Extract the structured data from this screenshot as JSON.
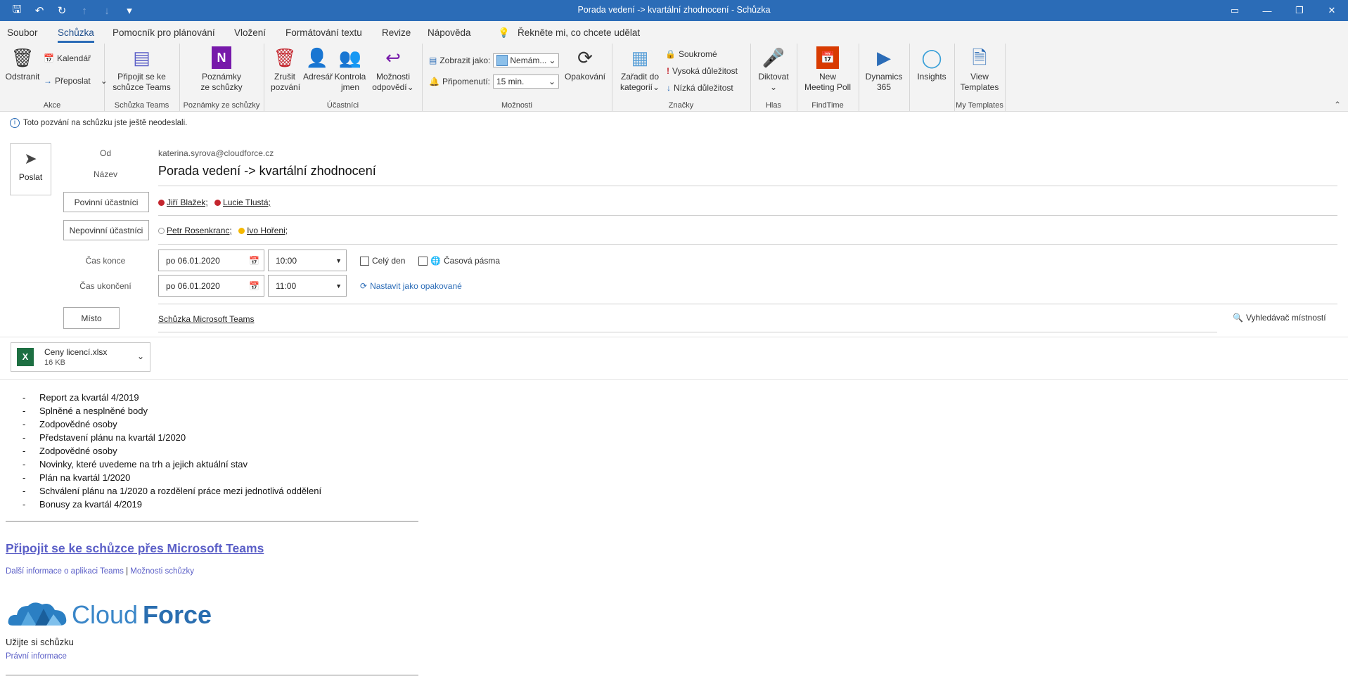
{
  "window": {
    "title": "Porada vedení -> kvartální zhodnocení  -  Schůzka"
  },
  "menu": {
    "tabs": [
      "Soubor",
      "Schůzka",
      "Pomocník pro plánování",
      "Vložení",
      "Formátování textu",
      "Revize",
      "Nápověda"
    ],
    "tell_me": "Řekněte mi, co chcete udělat"
  },
  "ribbon": {
    "akce": {
      "label": "Akce",
      "delete": "Odstranit",
      "calendar": "Kalendář",
      "forward": "Přeposlat"
    },
    "teams": {
      "label": "Schůzka Teams",
      "join_1": "Připojit se ke",
      "join_2": "schůzce Teams"
    },
    "notes": {
      "label": "Poznámky ze schůzky",
      "btn_1": "Poznámky",
      "btn_2": "ze schůzky"
    },
    "attendees": {
      "label": "Účastníci",
      "cancel_1": "Zrušit",
      "cancel_2": "pozvání",
      "address": "Adresář",
      "check_1": "Kontrola",
      "check_2": "jmen",
      "options_1": "Možnosti",
      "options_2": "odpovědí"
    },
    "options": {
      "label": "Možnosti",
      "show_as": "Zobrazit jako:",
      "show_as_value": "Nemám...",
      "reminder": "Připomenutí:",
      "reminder_value": "15 min.",
      "recurrence": "Opakování"
    },
    "tags": {
      "label": "Značky",
      "categorize_1": "Zařadit do",
      "categorize_2": "kategorií",
      "private": "Soukromé",
      "high": "Vysoká důležitost",
      "low": "Nízká důležitost"
    },
    "voice": {
      "label": "Hlas",
      "dictate": "Diktovat"
    },
    "findtime": {
      "label": "FindTime",
      "btn_1": "New",
      "btn_2": "Meeting Poll"
    },
    "dynamics": {
      "btn_1": "Dynamics",
      "btn_2": "365"
    },
    "insights": {
      "btn": "Insights"
    },
    "templates": {
      "label": "My Templates",
      "btn_1": "View",
      "btn_2": "Templates"
    }
  },
  "infobar": {
    "text": "Toto pozvání na schůzku jste ještě neodeslali."
  },
  "form": {
    "send": "Poslat",
    "from_label": "Od",
    "from_value": "katerina.syrova@cloudforce.cz",
    "subject_label": "Název",
    "subject_value": "Porada vedení -> kvartální zhodnocení",
    "required_btn": "Povinní účastníci",
    "required": [
      "Jiří Blažek;",
      "Lucie Tlustá;"
    ],
    "optional_btn": "Nepovinní účastníci",
    "optional": [
      "Petr Rosenkranc;",
      "Ivo Hořeni;"
    ],
    "start_label": "Čas konce",
    "start_date": "po 06.01.2020",
    "start_time": "10:00",
    "end_label": "Čas ukončení",
    "end_date": "po 06.01.2020",
    "end_time": "11:00",
    "allday": "Celý den",
    "timezones": "Časová pásma",
    "recurring": "Nastavit jako opakované",
    "location_btn": "Místo",
    "location_value": "Schůzka Microsoft Teams",
    "room_finder": "Vyhledávač místností"
  },
  "attachment": {
    "name": "Ceny licencí.xlsx",
    "size": "16 KB"
  },
  "body": {
    "items": [
      "Report za kvartál 4/2019",
      "Splněné a nesplněné body",
      "Zodpovědné osoby",
      "Představení plánu na kvartál 1/2020",
      "Zodpovědné osoby",
      "Novinky, které uvedeme na trh a jejich aktuální stav",
      "Plán na kvartál 1/2020",
      "Schválení plánu na 1/2020 a rozdělení práce mezi jednotlivá oddělení",
      "Bonusy za kvartál 4/2019"
    ],
    "join_link": "Připojit se ke schůzce přes Microsoft Teams",
    "more_info": "Další informace o aplikaci Teams",
    "separator": "|",
    "meeting_options": "Možnosti schůzky",
    "logo_cloud": "Cloud",
    "logo_force": "Force",
    "enjoy": "Užijte si schůzku",
    "legal": "Právní informace"
  }
}
